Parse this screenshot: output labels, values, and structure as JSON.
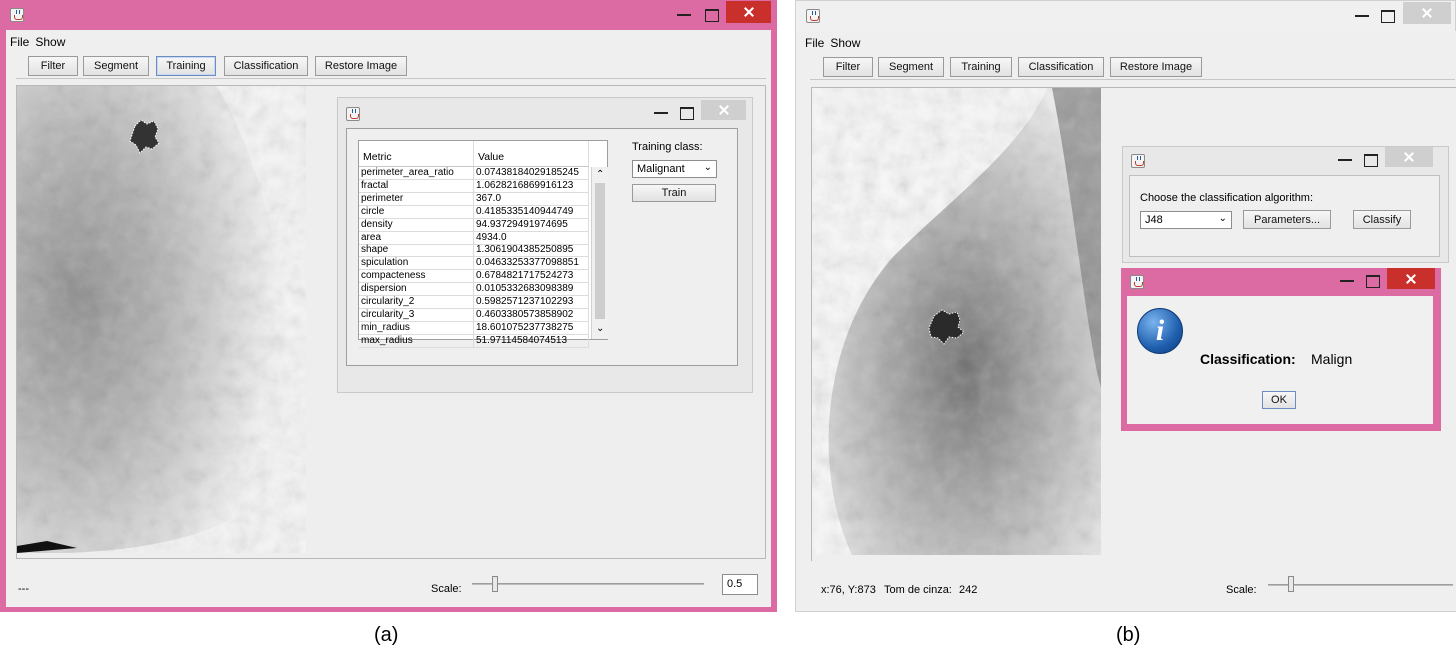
{
  "left_window": {
    "menu": [
      "File",
      "Show"
    ],
    "toolbar": {
      "filter": "Filter",
      "segment": "Segment",
      "training": "Training",
      "classification": "Classification",
      "restore": "Restore Image"
    },
    "training_dialog": {
      "columns": [
        "Metric",
        "Value"
      ],
      "rows": [
        [
          "perimeter_area_ratio",
          "0.07438184029185245"
        ],
        [
          "fractal",
          "1.0628216869916123"
        ],
        [
          "perimeter",
          "367.0"
        ],
        [
          "circle",
          "0.4185335140944749"
        ],
        [
          "density",
          "94.93729491974695"
        ],
        [
          "area",
          "4934.0"
        ],
        [
          "shape",
          "1.3061904385250895"
        ],
        [
          "spiculation",
          "0.04633253377098851"
        ],
        [
          "compacteness",
          "0.6784821717524273"
        ],
        [
          "dispersion",
          "0.0105332683098389"
        ],
        [
          "circularity_2",
          "0.5982571237102293"
        ],
        [
          "circularity_3",
          "0.4603380573858902"
        ],
        [
          "min_radius",
          "18.601075237738275"
        ],
        [
          "max_radius",
          "51.97114584074513"
        ]
      ],
      "training_class_label": "Training class:",
      "training_class_value": "Malignant",
      "train_button": "Train"
    },
    "status_text": "---",
    "scale_label": "Scale:",
    "scale_value": "0.5"
  },
  "right_window": {
    "menu": [
      "File",
      "Show"
    ],
    "toolbar": {
      "filter": "Filter",
      "segment": "Segment",
      "training": "Training",
      "classification": "Classification",
      "restore": "Restore Image"
    },
    "classification_dialog": {
      "prompt": "Choose the classification algorithm:",
      "algorithm": "J48",
      "parameters_button": "Parameters...",
      "classify_button": "Classify"
    },
    "message_dialog": {
      "label": "Classification:",
      "value": "Malign",
      "ok_button": "OK"
    },
    "status": {
      "coords": "x:76, Y:873",
      "gray_label": "Tom de cinza:",
      "gray_value": "242"
    },
    "scale_label": "Scale:"
  },
  "captions": {
    "a": "(a)",
    "b": "(b)"
  },
  "colors": {
    "frame": "#dc6ba3",
    "close": "#c9302c",
    "info_icon": "#1f5fae"
  }
}
